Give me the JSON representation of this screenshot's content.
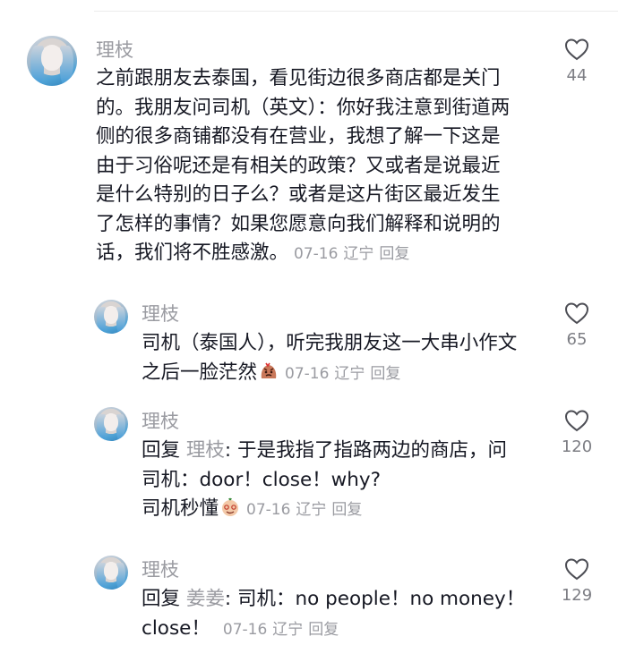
{
  "comments": [
    {
      "user": "理枝",
      "lines": [
        "之前跟朋友去泰国，看见街边很多商店都是关门",
        "的。我朋友问司机（英文）：你好我注意到街道两",
        "侧的很多商铺都没有在营业，我想了解一下这是",
        "由于习俗呢还是有相关的政策？又或者是说最近",
        "是什么特别的日子么？或者是这片街区最近发生",
        "了怎样的事情？如果您愿意向我们解释和说明的",
        "话，我们将不胜感激。"
      ],
      "date": "07-16",
      "location": "辽宁",
      "reply_label": "回复",
      "likes": "44"
    }
  ],
  "replies": [
    {
      "user": "理枝",
      "line1": "司机（泰国人），听完我朋友这一大串小作文",
      "line2": "之后一脸茫然",
      "emoji": "angry-face-emoji",
      "date": "07-16",
      "location": "辽宁",
      "reply_label": "回复",
      "likes": "65"
    },
    {
      "user": "理枝",
      "reply_prefix": "回复",
      "reply_to": "理枝",
      "line1_text": ": 于是我指了指路两边的商店，问",
      "line2": "司机：door！close！why?",
      "line3": "司机秒懂",
      "emoji": "smiling-face-emoji",
      "date": "07-16",
      "location": "辽宁",
      "reply_label": "回复",
      "likes": "120"
    },
    {
      "user": "理枝",
      "reply_prefix": "回复",
      "reply_to": "姜姜",
      "line1_text": ": 司机：no people！no money！",
      "line2": "close！",
      "date": "07-16",
      "location": "辽宁",
      "reply_label": "回复",
      "likes": "129"
    }
  ],
  "colors": {
    "text": "#161823",
    "muted": "#9a9ba1",
    "count": "#7d7e84",
    "avatar_accent": "#3d9ad8"
  },
  "icons": [
    "heart-outline-icon",
    "avatar-image"
  ]
}
